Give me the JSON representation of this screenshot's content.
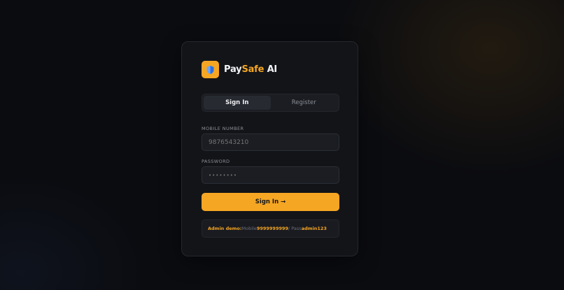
{
  "brand": {
    "name_part1": "Pay",
    "name_part2": "Safe",
    "name_part3": " AI",
    "logo_icon": "shield-icon"
  },
  "tabs": [
    {
      "label": "Sign In",
      "active": true
    },
    {
      "label": "Register",
      "active": false
    }
  ],
  "form": {
    "mobile_label": "MOBILE NUMBER",
    "mobile_placeholder": "9876543210",
    "password_label": "PASSWORD",
    "password_placeholder": "••••••••",
    "submit_label": "Sign In →"
  },
  "admin_hint": {
    "prefix": "Admin demo:",
    "mobile_text": " Mobile ",
    "mobile_value": "9999999999",
    "sep_text": " / Pass ",
    "pass_value": "admin123"
  },
  "colors": {
    "accent": "#f5a623",
    "background": "#0b0c10",
    "card": "#131418"
  }
}
